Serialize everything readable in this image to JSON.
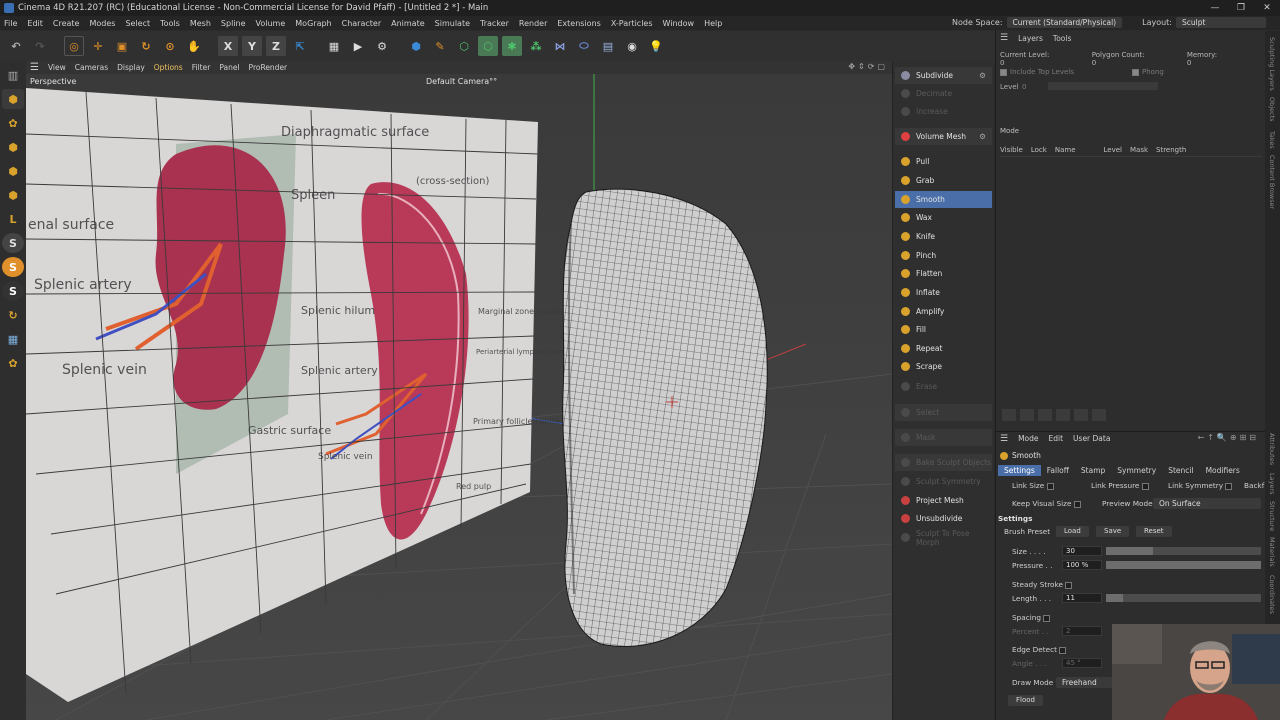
{
  "window": {
    "title": "Cinema 4D R21.207 (RC) (Educational License - Non-Commercial License for David Pfaff) - [Untitled 2 *] - Main",
    "controls": [
      "—",
      "❐",
      "✕"
    ]
  },
  "menu": {
    "items": [
      "File",
      "Edit",
      "Create",
      "Modes",
      "Select",
      "Tools",
      "Mesh",
      "Spline",
      "Volume",
      "MoGraph",
      "Character",
      "Animate",
      "Simulate",
      "Tracker",
      "Render",
      "Extensions",
      "X-Particles",
      "Window",
      "Help"
    ],
    "node_space_label": "Node Space:",
    "node_space_value": "Current (Standard/Physical)",
    "layout_label": "Layout:",
    "layout_value": "Sculpt"
  },
  "viewport_menu": {
    "items": [
      "View",
      "Cameras",
      "Display",
      "Options",
      "Filter",
      "Panel",
      "ProRender"
    ],
    "view_label": "Perspective",
    "camera_label": "Default Camera°°"
  },
  "image_plane": {
    "labels": [
      "Diaphragmatic surface",
      "Spleen",
      "(cross-section)",
      "enal surface",
      "Splenic artery",
      "Splenic hilum",
      "Splenic vein",
      "Splenic artery",
      "Marginal zone (white pulp)",
      "Periarterial lymphoid sheath (PALS) (white pulp)",
      "Gastric surface",
      "Splenic vein",
      "Primary follicle (white pulp)",
      "Red pulp"
    ]
  },
  "sculpt_panel": {
    "subdivide": "Subdivide",
    "decimate": "Decimate",
    "increase": "Increase",
    "volume_mesh": "Volume Mesh",
    "brushes": [
      "Pull",
      "Grab",
      "Smooth",
      "Wax",
      "Knife",
      "Pinch",
      "Flatten",
      "Inflate",
      "Amplify",
      "Fill",
      "Repeat",
      "Scrape"
    ],
    "active_brush": "Smooth",
    "erase": "Erase",
    "select": "Select",
    "mask": "Mask",
    "bake": "Bake Sculpt Objects",
    "sculpt_symmetry": "Sculpt Symmetry",
    "project_mesh": "Project Mesh",
    "unsubdivide": "Unsubdivide",
    "sculpt_to_pose": "Sculpt To Pose Morph"
  },
  "layers_panel": {
    "tabs": [
      "Layers",
      "Tools"
    ],
    "current_level": "Current Level: 0",
    "polygon_count": "Polygon Count: 0",
    "memory": "Memory: 0",
    "include_top": "Include Top Levels",
    "phong": "Phong",
    "level_label": "Level",
    "level_value": "0",
    "mode_label": "Mode",
    "columns": [
      "Visible",
      "Lock",
      "Name",
      "Level",
      "Mask",
      "Strength"
    ]
  },
  "attributes": {
    "menu": [
      "Mode",
      "Edit",
      "User Data"
    ],
    "object": "Smooth",
    "tabs": [
      "Settings",
      "Falloff",
      "Stamp",
      "Symmetry",
      "Stencil",
      "Modifiers"
    ],
    "active_tab": "Settings",
    "link_size": "Link Size",
    "link_pressure": "Link Pressure",
    "link_symmetry": "Link Symmetry",
    "backface": "Backf",
    "keep_visual_size": "Keep Visual Size",
    "preview_mode_label": "Preview Mode",
    "preview_mode_value": "On Surface",
    "settings_heading": "Settings",
    "brush_preset": "Brush Preset",
    "load": "Load",
    "save": "Save",
    "reset": "Reset",
    "size_label": "Size . . . .",
    "size_value": "30",
    "size_fraction": 0.3,
    "pressure_label": "Pressure . .",
    "pressure_value": "100 %",
    "pressure_fraction": 1.0,
    "steady_stroke": "Steady Stroke",
    "length_label": "Length . . .",
    "length_value": "11",
    "length_fraction": 0.11,
    "spacing": "Spacing",
    "percent_label": "Percent . .",
    "percent_value": "2",
    "edge_detect": "Edge Detect",
    "angle_label": "Angle . . .",
    "angle_value": "45 °",
    "draw_mode_label": "Draw Mode",
    "draw_mode_value": "Freehand",
    "flood": "Flood"
  },
  "side_tabs": [
    "Sculpting Layers",
    "Objects",
    "Takes",
    "Content Browser",
    "Attributes",
    "Layers",
    "Structure",
    "Materials",
    "Coordinates"
  ],
  "colors": {
    "accent": "#4a6fa8",
    "brush_icon": "#d9a22c",
    "toolbar_orange": "#e0902a",
    "toolbar_blue": "#3a8ad6"
  }
}
